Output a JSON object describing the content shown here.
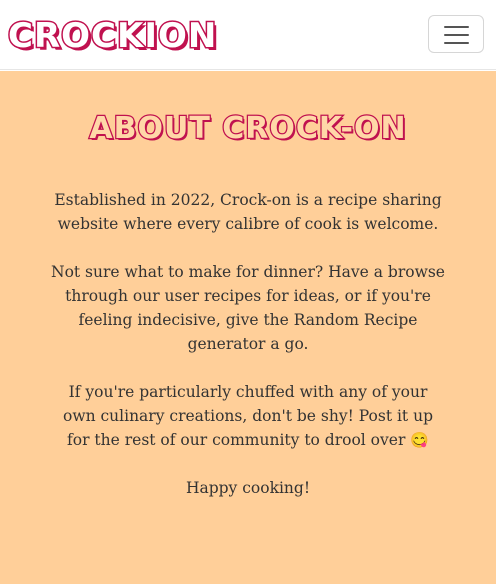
{
  "navbar": {
    "brand": "CROCKION",
    "toggler_icon": "hamburger-menu-icon"
  },
  "main": {
    "title": "ABOUT CROCK-ON",
    "paragraphs": [
      "Established in 2022, Crock-on is a recipe sharing website where every calibre of cook is welcome.",
      "Not sure what to make for dinner? Have a browse through our user recipes for ideas, or if you're feeling indecisive, give the Random Recipe generator a go.",
      "If you're particularly chuffed with any of your own culinary creations, don't be shy! Post it up for the rest of our community to drool over",
      "Happy cooking!"
    ],
    "emoji": "😋"
  },
  "colors": {
    "brand": "#c0114f",
    "background": "#ffcf99",
    "text": "#333333"
  }
}
